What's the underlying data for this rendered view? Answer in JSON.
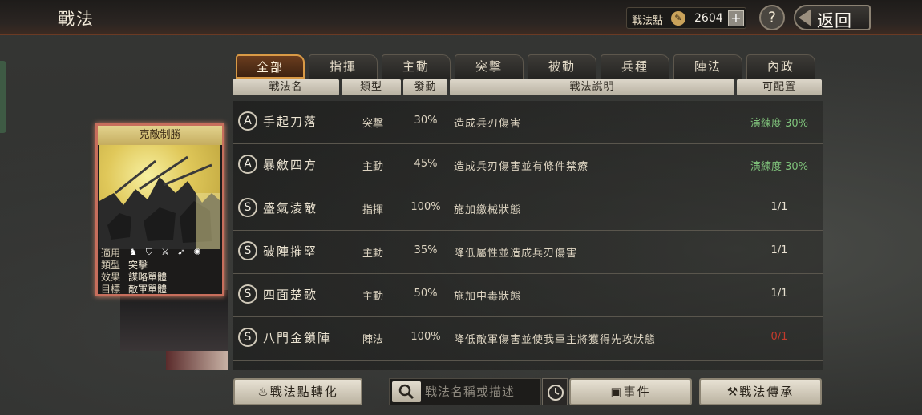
{
  "header": {
    "title": "戰法",
    "points_label": "戰法點",
    "points_value": "2604",
    "help_label": "?",
    "back_label": "返回"
  },
  "card": {
    "title": "克敵制勝",
    "rows": [
      {
        "key": "適用",
        "value": ""
      },
      {
        "key": "類型",
        "value": "突擊"
      },
      {
        "key": "效果",
        "value": "謀略單體"
      },
      {
        "key": "目標",
        "value": "敵軍單體"
      }
    ]
  },
  "tabs": [
    {
      "label": "全部",
      "active": true
    },
    {
      "label": "指揮",
      "active": false
    },
    {
      "label": "主動",
      "active": false
    },
    {
      "label": "突擊",
      "active": false
    },
    {
      "label": "被動",
      "active": false
    },
    {
      "label": "兵種",
      "active": false
    },
    {
      "label": "陣法",
      "active": false
    },
    {
      "label": "內政",
      "active": false
    }
  ],
  "columns": [
    "戰法名",
    "類型",
    "發動",
    "戰法說明",
    "可配置"
  ],
  "rows": [
    {
      "grade": "A",
      "name": "手起刀落",
      "type": "突擊",
      "rate": "30%",
      "desc": "造成兵刃傷害",
      "avail": "演練度 30%",
      "avail_color": "green"
    },
    {
      "grade": "A",
      "name": "暴斂四方",
      "type": "主動",
      "rate": "45%",
      "desc": "造成兵刃傷害並有條件禁療",
      "avail": "演練度 30%",
      "avail_color": "green"
    },
    {
      "grade": "S",
      "name": "盛氣淩敵",
      "type": "指揮",
      "rate": "100%",
      "desc": "施加繳械狀態",
      "avail": "1/1",
      "avail_color": "normal"
    },
    {
      "grade": "S",
      "name": "破陣摧堅",
      "type": "主動",
      "rate": "35%",
      "desc": "降低屬性並造成兵刃傷害",
      "avail": "1/1",
      "avail_color": "normal"
    },
    {
      "grade": "S",
      "name": "四面楚歌",
      "type": "主動",
      "rate": "50%",
      "desc": "施加中毒狀態",
      "avail": "1/1",
      "avail_color": "normal"
    },
    {
      "grade": "S",
      "name": "八門金鎖陣",
      "type": "陣法",
      "rate": "100%",
      "desc": "降低敵軍傷害並使我軍主將獲得先攻狀態",
      "avail": "0/1",
      "avail_color": "red"
    }
  ],
  "bottom": {
    "convert_label": "戰法點轉化",
    "search_placeholder": "戰法名稱或描述",
    "events_label": "事件",
    "inherit_label": "戰法傳承"
  }
}
